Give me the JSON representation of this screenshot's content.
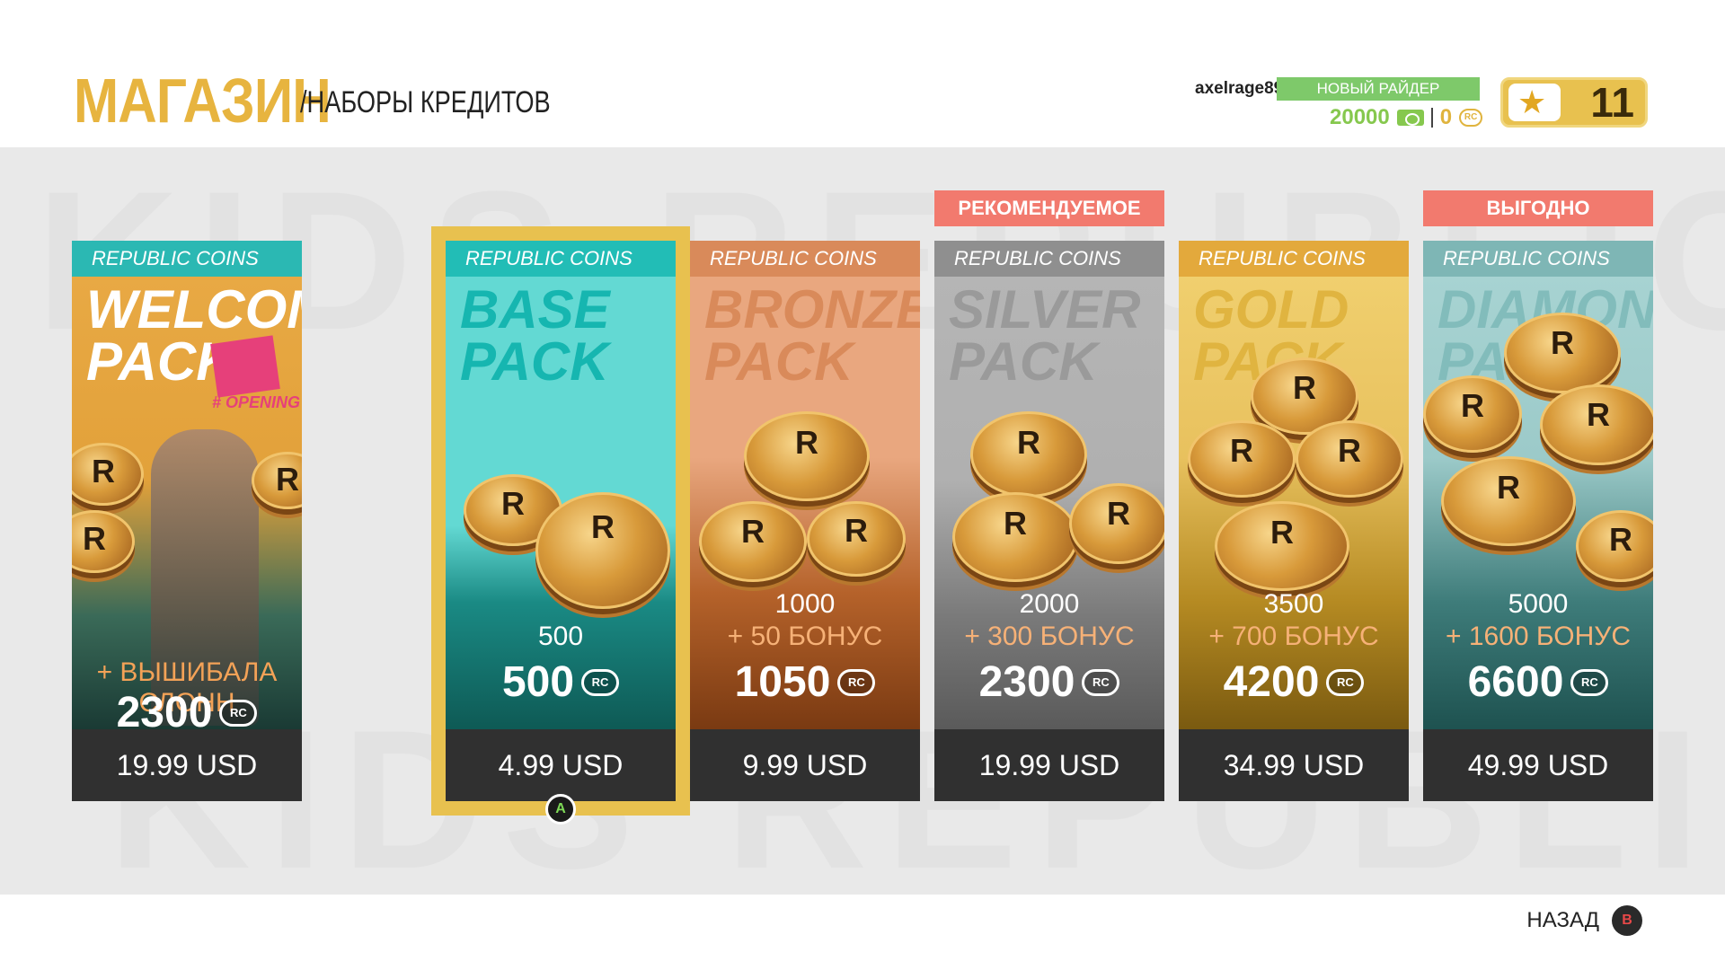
{
  "header": {
    "title": "МАГАЗИН",
    "subtitle": "/НАБОРЫ КРЕДИТОВ",
    "username": "axelrage89",
    "rank": "НОВЫЙ РАЙДЕР",
    "credits": "20000",
    "credits_icon": "cash-icon",
    "rc_balance": "0",
    "rc_icon": "rc-coin-icon",
    "rc_short": "RC",
    "level": "11"
  },
  "tags": {
    "recommended": "РЕКОМЕНДУЕМОЕ",
    "best_value": "ВЫГОДНО"
  },
  "packs": [
    {
      "category": "REPUBLIC COINS",
      "name_line1": "WELCOME",
      "name_line2": "PACK",
      "badge": "# OPENING",
      "bonus": "+ ВЫШИБАЛА СЛОНН",
      "total": "2300",
      "price": "19.99 USD"
    },
    {
      "category": "REPUBLIC COINS",
      "name_line1": "BASE",
      "name_line2": "PACK",
      "amount": "500",
      "total": "500",
      "price": "4.99 USD"
    },
    {
      "category": "REPUBLIC COINS",
      "name_line1": "BRONZE",
      "name_line2": "PACK",
      "amount": "1000",
      "bonus": "+ 50 БОНУС",
      "total": "1050",
      "price": "9.99 USD"
    },
    {
      "category": "REPUBLIC COINS",
      "name_line1": "SILVER",
      "name_line2": "PACK",
      "amount": "2000",
      "bonus": "+ 300 БОНУС",
      "total": "2300",
      "price": "19.99 USD"
    },
    {
      "category": "REPUBLIC COINS",
      "name_line1": "GOLD",
      "name_line2": "PACK",
      "amount": "3500",
      "bonus": "+ 700 БОНУС",
      "total": "4200",
      "price": "34.99 USD"
    },
    {
      "category": "REPUBLIC COINS",
      "name_line1": "DIAMOND",
      "name_line2": "PACK",
      "amount": "5000",
      "bonus": "+ 1600 БОНУС",
      "total": "6600",
      "price": "49.99 USD"
    }
  ],
  "controls": {
    "select_button": "A",
    "back_label": "НАЗАД",
    "back_button": "B"
  },
  "colors": {
    "accent_gold": "#e7b43f",
    "rank_green": "#7ec96a",
    "tag_red": "#f27a6e",
    "price_bar": "#303030"
  }
}
